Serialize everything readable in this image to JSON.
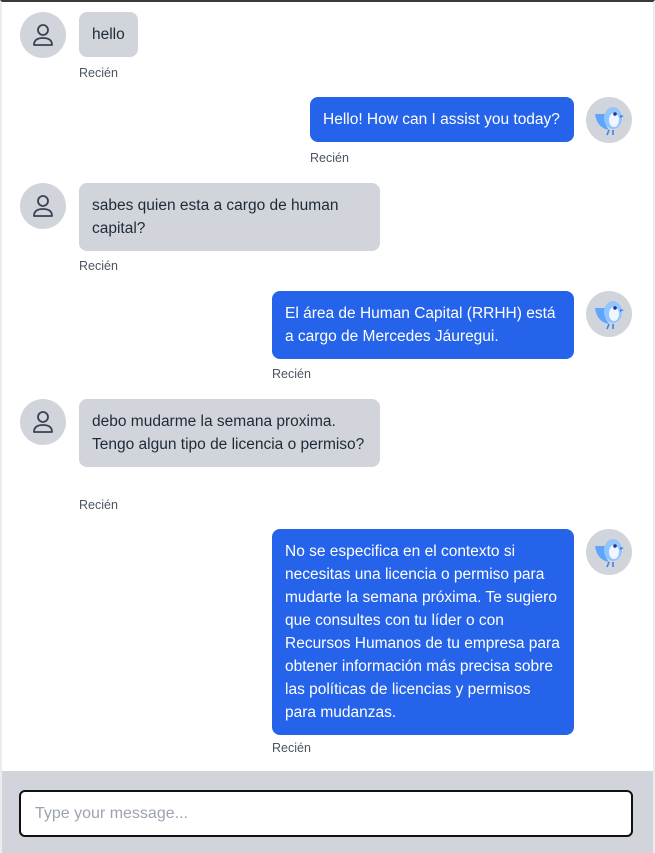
{
  "messages": [
    {
      "sender": "user",
      "text": "hello",
      "time": "Recién"
    },
    {
      "sender": "bot",
      "text": "Hello! How can I assist you today?",
      "time": "Recién"
    },
    {
      "sender": "user",
      "text": "sabes quien esta a cargo de human capital?",
      "time": "Recién"
    },
    {
      "sender": "bot",
      "text": "El área de Human Capital (RRHH) está a cargo de Mercedes Jáuregui.",
      "time": "Recién"
    },
    {
      "sender": "user",
      "text": "debo mudarme la semana proxima. Tengo algun tipo de licencia o permiso?",
      "time": "Recién"
    },
    {
      "sender": "bot",
      "text": "No se especifica en el contexto si necesitas una licencia o permiso para mudarte la semana próxima. Te sugiero que consultes con tu líder o con Recursos Humanos de tu empresa para obtener información más precisa sobre las políticas de licencias y permisos para mudanzas.",
      "time": "Recién"
    }
  ],
  "composer": {
    "placeholder": "Type your message...",
    "value": ""
  },
  "colors": {
    "user_bubble": "#d1d5db",
    "bot_bubble": "#2563eb",
    "avatar_bg": "#d1d5db"
  },
  "icons": {
    "user_avatar": "user-outline-icon",
    "bot_avatar": "bird-mascot-icon"
  }
}
